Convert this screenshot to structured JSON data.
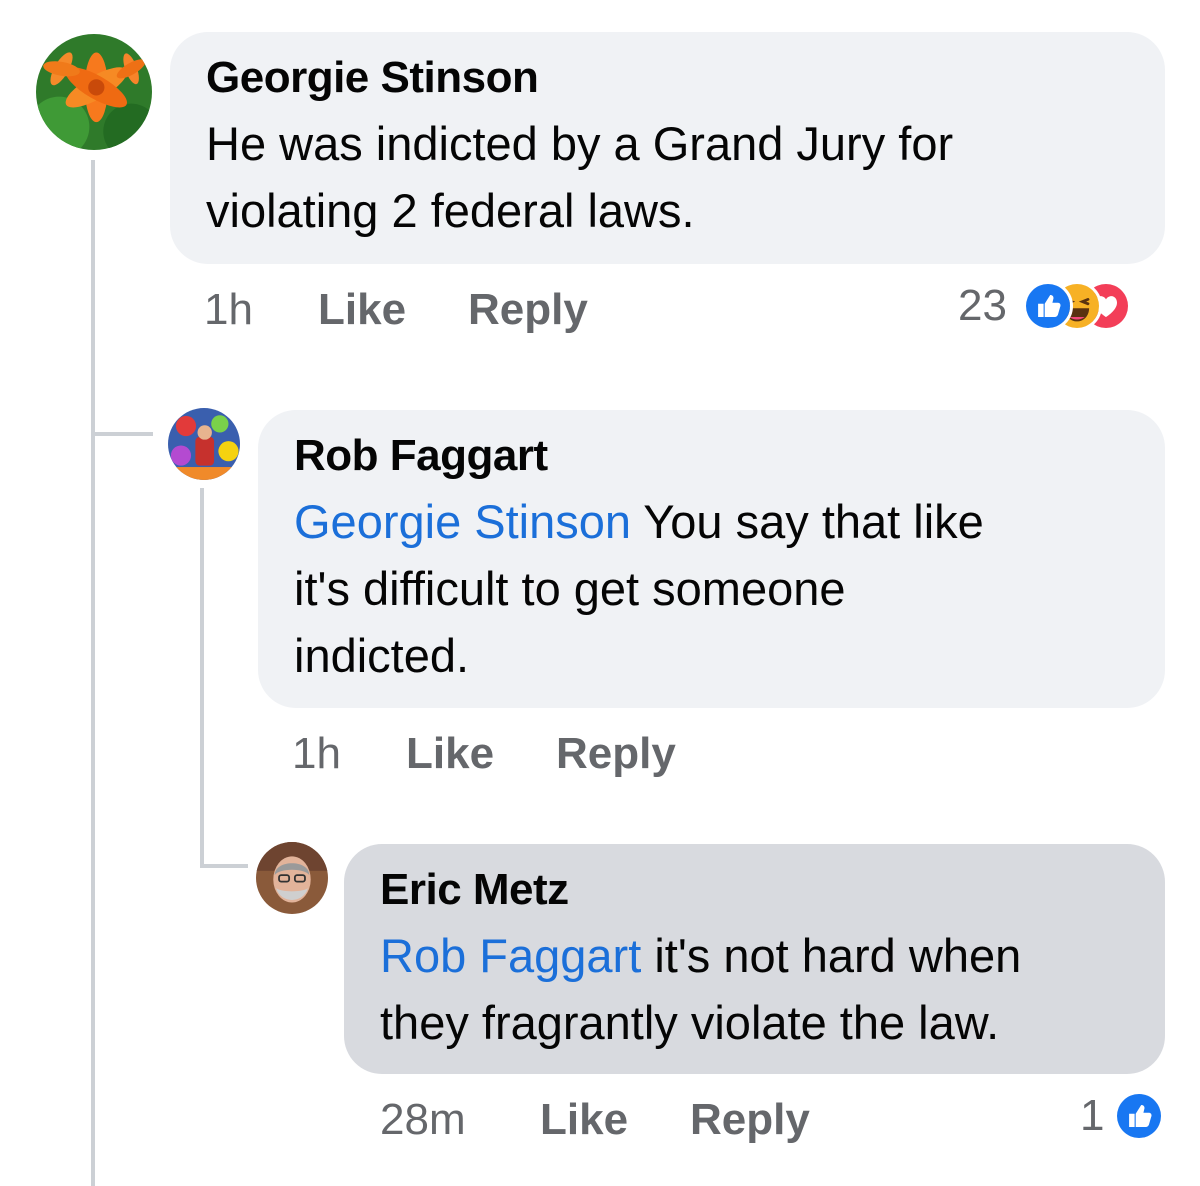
{
  "comments": [
    {
      "author": "Georgie Stinson",
      "text": "He was indicted by a Grand Jury for violating 2 federal laws.",
      "time": "1h",
      "like_label": "Like",
      "reply_label": "Reply",
      "reaction_count": "23",
      "reactions": [
        "like-icon",
        "haha-icon",
        "love-icon"
      ],
      "replies": [
        {
          "author": "Rob Faggart",
          "mention": "Georgie Stinson",
          "text_line1": " You say that like",
          "text_line2": "it's difficult to get someone",
          "text_line3": "indicted.",
          "time": "1h",
          "like_label": "Like",
          "reply_label": "Reply"
        },
        {
          "author": "Eric Metz",
          "mention": "Rob Faggart",
          "text_line1": " it's not hard when",
          "text_line2": "they fragrantly violate the law.",
          "time": "28m",
          "like_label": "Like",
          "reply_label": "Reply",
          "reaction_count": "1",
          "reactions": [
            "like-icon"
          ]
        }
      ]
    }
  ],
  "colors": {
    "bubble": "#f0f2f5",
    "bubble_highlight": "#d8dadf",
    "mention": "#1b6fd9",
    "meta": "#65676b",
    "like_blue": "#1877f2",
    "love_red": "#f33e58",
    "haha_yellow": "#f7b125"
  }
}
